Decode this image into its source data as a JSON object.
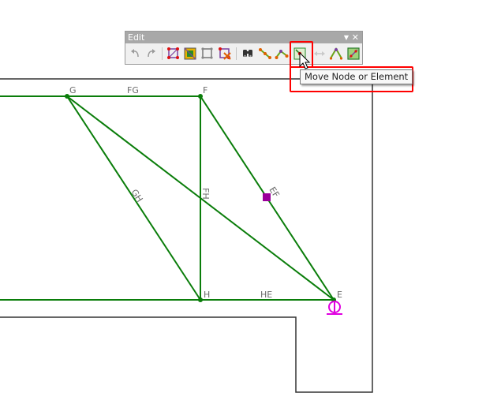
{
  "toolbar": {
    "title": "Edit",
    "menu_glyph": "▼",
    "close_glyph": "✕",
    "tools": [
      {
        "icon": "undo-icon",
        "state": "disabled"
      },
      {
        "icon": "redo-icon",
        "state": "disabled"
      },
      {
        "icon": "add-node-icon",
        "state": "enabled"
      },
      {
        "icon": "add-element-icon",
        "state": "enabled"
      },
      {
        "icon": "edit-geometry-icon",
        "state": "enabled"
      },
      {
        "icon": "delete-node-icon",
        "state": "enabled"
      },
      {
        "icon": "find-icon",
        "state": "enabled"
      },
      {
        "icon": "split-element-icon",
        "state": "enabled"
      },
      {
        "icon": "connect-nodes-icon",
        "state": "enabled"
      },
      {
        "icon": "move-node-or-element-icon",
        "state": "active"
      },
      {
        "icon": "mirror-icon",
        "state": "disabled"
      },
      {
        "icon": "rotate-icon",
        "state": "enabled"
      },
      {
        "icon": "grid-snap-icon",
        "state": "enabled"
      }
    ]
  },
  "tooltip": {
    "text": "Move Node or Element"
  },
  "model": {
    "nodes": [
      {
        "id": "G",
        "label": "G"
      },
      {
        "id": "F",
        "label": "F"
      },
      {
        "id": "H",
        "label": "H"
      },
      {
        "id": "E",
        "label": "E"
      }
    ],
    "elements": [
      {
        "id": "FG",
        "label": "FG"
      },
      {
        "id": "GH",
        "label": "GH"
      },
      {
        "id": "FH",
        "label": "FH"
      },
      {
        "id": "EF",
        "label": "EF"
      },
      {
        "id": "HE",
        "label": "HE"
      },
      {
        "id": "GE",
        "label": ""
      }
    ],
    "colors": {
      "element": "#0a7d0a",
      "node": "#0a7d0a",
      "selected_handle": "#9b009b",
      "support": "#e000e0",
      "outline": "#333333",
      "label": "#6b6b6b",
      "highlight": "#ff0000"
    }
  }
}
